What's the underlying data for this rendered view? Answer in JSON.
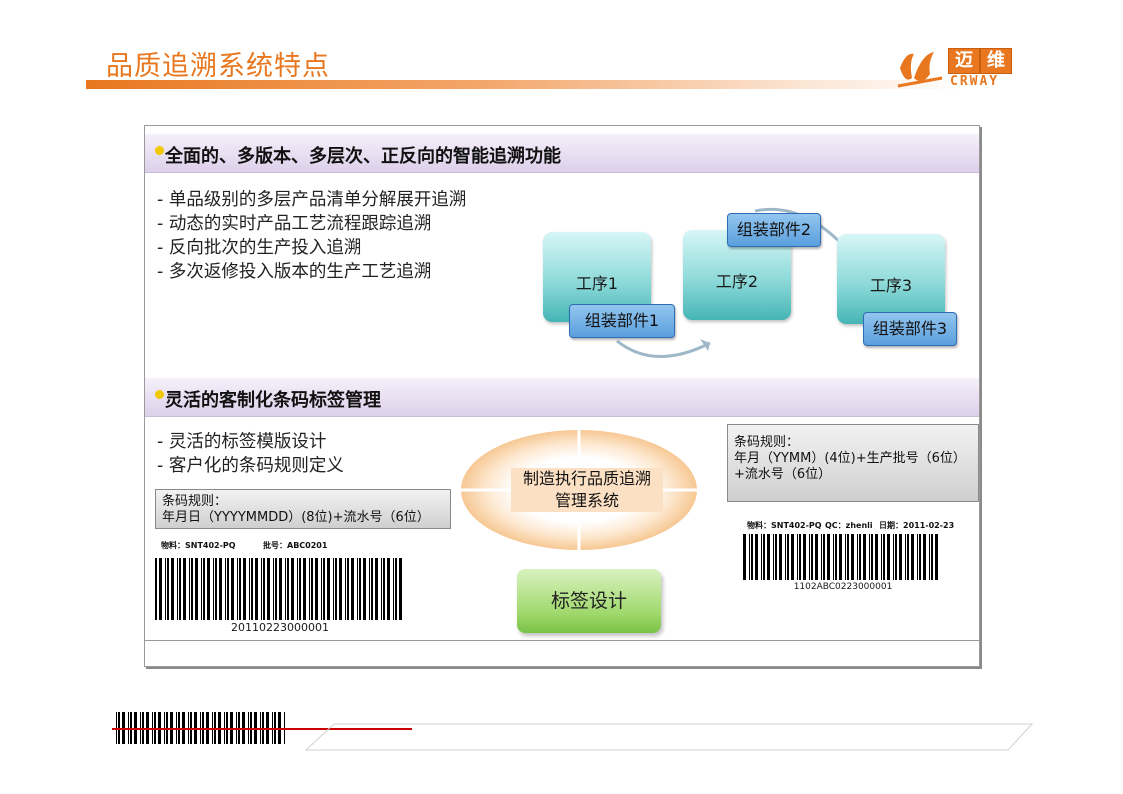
{
  "header": {
    "title": "品质追溯系统特点",
    "logo": {
      "zh_1": "迈",
      "zh_2": "维",
      "en": "CRWAY"
    }
  },
  "section1": {
    "heading": "全面的、多版本、多层次、正反向的智能追溯功能",
    "bullets": [
      "- 单品级别的多层产品清单分解展开追溯",
      "- 动态的实时产品工艺流程跟踪追溯",
      "- 反向批次的生产投入追溯",
      "- 多次返修投入版本的生产工艺追溯"
    ],
    "processes": [
      "工序1",
      "工序2",
      "工序3"
    ],
    "parts": [
      "组装部件1",
      "组装部件2",
      "组装部件3"
    ]
  },
  "section2": {
    "heading": "灵活的客制化条码标签管理",
    "bullets": [
      "- 灵活的标签模版设计",
      "- 客户化的条码规则定义"
    ],
    "rule_left": {
      "line1": "条码规则：",
      "line2": "年月日（YYYYMMDD）(8位)+流水号（6位）"
    },
    "rule_right": {
      "line1": "条码规则：",
      "line2": "年月（YYMM）(4位)+生产批号（6位）",
      "line3": "+流水号（6位）"
    },
    "center_system": {
      "line1": "制造执行品质追溯",
      "line2": "管理系统"
    },
    "design_button": "标签设计",
    "label_left": {
      "material": "物料：SNT402-PQ",
      "batch": "批号：ABC0201",
      "number": "20110223000001"
    },
    "label_right": {
      "material": "物料：SNT402-PQ",
      "qc": "QC：zhenli",
      "date": "日期：2011-02-23",
      "number": "1102ABC0223000001"
    }
  },
  "colors": {
    "accent": "#e8771f",
    "header_band": "#ddd0ea",
    "process": "#8fdada",
    "part": "#5a9fdc",
    "design": "#9fd86b"
  }
}
